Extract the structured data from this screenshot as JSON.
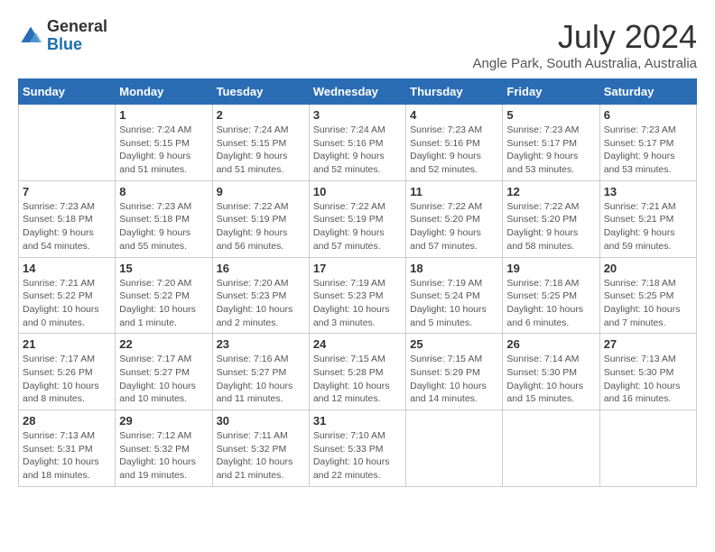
{
  "header": {
    "logo": {
      "general": "General",
      "blue": "Blue"
    },
    "title": "July 2024",
    "location": "Angle Park, South Australia, Australia"
  },
  "weekdays": [
    "Sunday",
    "Monday",
    "Tuesday",
    "Wednesday",
    "Thursday",
    "Friday",
    "Saturday"
  ],
  "weeks": [
    [
      {
        "day": "",
        "info": ""
      },
      {
        "day": "1",
        "info": "Sunrise: 7:24 AM\nSunset: 5:15 PM\nDaylight: 9 hours\nand 51 minutes."
      },
      {
        "day": "2",
        "info": "Sunrise: 7:24 AM\nSunset: 5:15 PM\nDaylight: 9 hours\nand 51 minutes."
      },
      {
        "day": "3",
        "info": "Sunrise: 7:24 AM\nSunset: 5:16 PM\nDaylight: 9 hours\nand 52 minutes."
      },
      {
        "day": "4",
        "info": "Sunrise: 7:23 AM\nSunset: 5:16 PM\nDaylight: 9 hours\nand 52 minutes."
      },
      {
        "day": "5",
        "info": "Sunrise: 7:23 AM\nSunset: 5:17 PM\nDaylight: 9 hours\nand 53 minutes."
      },
      {
        "day": "6",
        "info": "Sunrise: 7:23 AM\nSunset: 5:17 PM\nDaylight: 9 hours\nand 53 minutes."
      }
    ],
    [
      {
        "day": "7",
        "info": "Sunrise: 7:23 AM\nSunset: 5:18 PM\nDaylight: 9 hours\nand 54 minutes."
      },
      {
        "day": "8",
        "info": "Sunrise: 7:23 AM\nSunset: 5:18 PM\nDaylight: 9 hours\nand 55 minutes."
      },
      {
        "day": "9",
        "info": "Sunrise: 7:22 AM\nSunset: 5:19 PM\nDaylight: 9 hours\nand 56 minutes."
      },
      {
        "day": "10",
        "info": "Sunrise: 7:22 AM\nSunset: 5:19 PM\nDaylight: 9 hours\nand 57 minutes."
      },
      {
        "day": "11",
        "info": "Sunrise: 7:22 AM\nSunset: 5:20 PM\nDaylight: 9 hours\nand 57 minutes."
      },
      {
        "day": "12",
        "info": "Sunrise: 7:22 AM\nSunset: 5:20 PM\nDaylight: 9 hours\nand 58 minutes."
      },
      {
        "day": "13",
        "info": "Sunrise: 7:21 AM\nSunset: 5:21 PM\nDaylight: 9 hours\nand 59 minutes."
      }
    ],
    [
      {
        "day": "14",
        "info": "Sunrise: 7:21 AM\nSunset: 5:22 PM\nDaylight: 10 hours\nand 0 minutes."
      },
      {
        "day": "15",
        "info": "Sunrise: 7:20 AM\nSunset: 5:22 PM\nDaylight: 10 hours\nand 1 minute."
      },
      {
        "day": "16",
        "info": "Sunrise: 7:20 AM\nSunset: 5:23 PM\nDaylight: 10 hours\nand 2 minutes."
      },
      {
        "day": "17",
        "info": "Sunrise: 7:19 AM\nSunset: 5:23 PM\nDaylight: 10 hours\nand 3 minutes."
      },
      {
        "day": "18",
        "info": "Sunrise: 7:19 AM\nSunset: 5:24 PM\nDaylight: 10 hours\nand 5 minutes."
      },
      {
        "day": "19",
        "info": "Sunrise: 7:18 AM\nSunset: 5:25 PM\nDaylight: 10 hours\nand 6 minutes."
      },
      {
        "day": "20",
        "info": "Sunrise: 7:18 AM\nSunset: 5:25 PM\nDaylight: 10 hours\nand 7 minutes."
      }
    ],
    [
      {
        "day": "21",
        "info": "Sunrise: 7:17 AM\nSunset: 5:26 PM\nDaylight: 10 hours\nand 8 minutes."
      },
      {
        "day": "22",
        "info": "Sunrise: 7:17 AM\nSunset: 5:27 PM\nDaylight: 10 hours\nand 10 minutes."
      },
      {
        "day": "23",
        "info": "Sunrise: 7:16 AM\nSunset: 5:27 PM\nDaylight: 10 hours\nand 11 minutes."
      },
      {
        "day": "24",
        "info": "Sunrise: 7:15 AM\nSunset: 5:28 PM\nDaylight: 10 hours\nand 12 minutes."
      },
      {
        "day": "25",
        "info": "Sunrise: 7:15 AM\nSunset: 5:29 PM\nDaylight: 10 hours\nand 14 minutes."
      },
      {
        "day": "26",
        "info": "Sunrise: 7:14 AM\nSunset: 5:30 PM\nDaylight: 10 hours\nand 15 minutes."
      },
      {
        "day": "27",
        "info": "Sunrise: 7:13 AM\nSunset: 5:30 PM\nDaylight: 10 hours\nand 16 minutes."
      }
    ],
    [
      {
        "day": "28",
        "info": "Sunrise: 7:13 AM\nSunset: 5:31 PM\nDaylight: 10 hours\nand 18 minutes."
      },
      {
        "day": "29",
        "info": "Sunrise: 7:12 AM\nSunset: 5:32 PM\nDaylight: 10 hours\nand 19 minutes."
      },
      {
        "day": "30",
        "info": "Sunrise: 7:11 AM\nSunset: 5:32 PM\nDaylight: 10 hours\nand 21 minutes."
      },
      {
        "day": "31",
        "info": "Sunrise: 7:10 AM\nSunset: 5:33 PM\nDaylight: 10 hours\nand 22 minutes."
      },
      {
        "day": "",
        "info": ""
      },
      {
        "day": "",
        "info": ""
      },
      {
        "day": "",
        "info": ""
      }
    ]
  ]
}
